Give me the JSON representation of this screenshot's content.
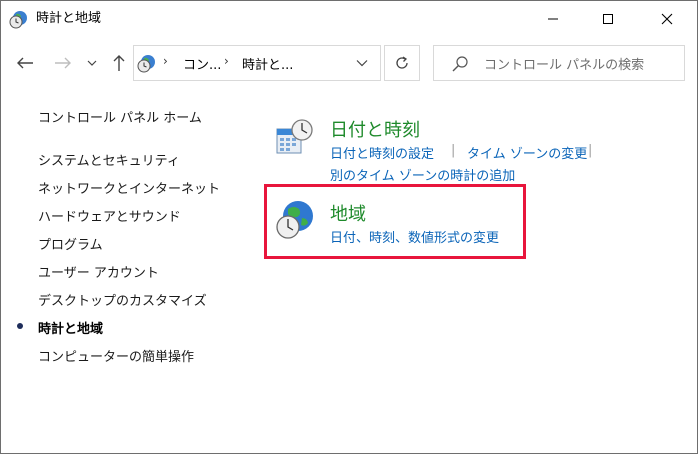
{
  "window": {
    "title": "時計と地域",
    "controls": {
      "minimize_icon": "minimize-icon",
      "maximize_icon": "maximize-icon",
      "close_icon": "close-icon"
    }
  },
  "address": {
    "crumbs": [
      "コン...",
      "時計と..."
    ],
    "separator": "›"
  },
  "search": {
    "placeholder": "コントロール パネルの検索"
  },
  "sidebar": {
    "home": "コントロール パネル ホーム",
    "items": [
      {
        "label": "システムとセキュリティ",
        "current": false
      },
      {
        "label": "ネットワークとインターネット",
        "current": false
      },
      {
        "label": "ハードウェアとサウンド",
        "current": false
      },
      {
        "label": "プログラム",
        "current": false
      },
      {
        "label": "ユーザー アカウント",
        "current": false
      },
      {
        "label": "デスクトップのカスタマイズ",
        "current": false
      },
      {
        "label": "時計と地域",
        "current": true
      },
      {
        "label": "コンピューターの簡単操作",
        "current": false
      }
    ]
  },
  "categories": [
    {
      "title": "日付と時刻",
      "icon": "calendar-clock-icon",
      "links": [
        "日付と時刻の設定",
        "タイム ゾーンの変更",
        "別のタイム ゾーンの時計の追加"
      ]
    },
    {
      "title": "地域",
      "icon": "globe-clock-icon",
      "links": [
        "日付、時刻、数値形式の変更"
      ],
      "highlighted": true
    }
  ],
  "colors": {
    "category_title": "#1e8a2b",
    "link": "#0a64b8",
    "highlight_border": "#e8153c"
  }
}
